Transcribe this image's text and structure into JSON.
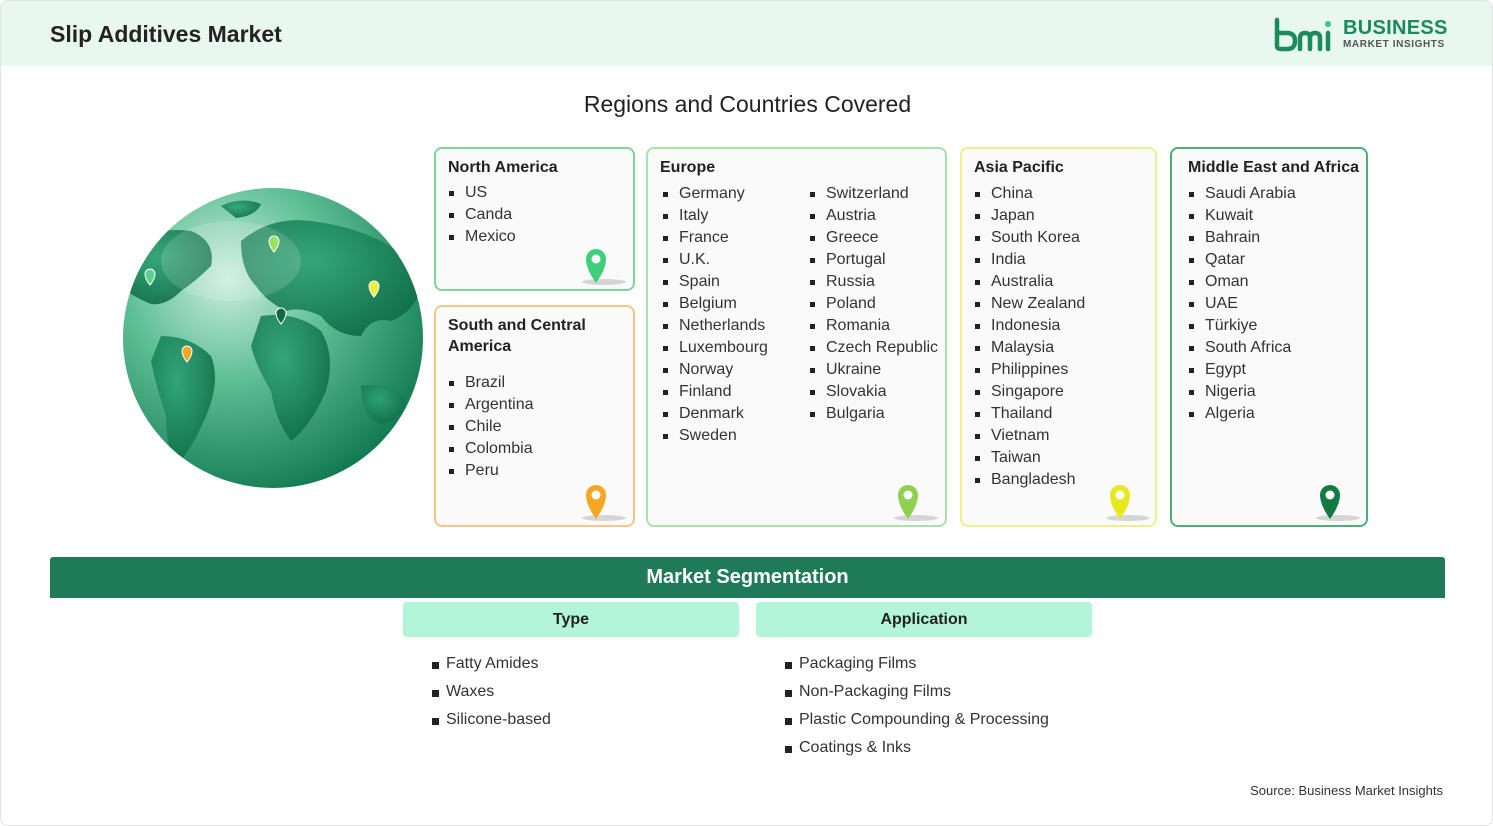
{
  "header": {
    "title": "Slip Additives Market"
  },
  "logo": {
    "mark": "bmi",
    "line1": "BUSINESS",
    "line2": "MARKET INSIGHTS"
  },
  "regions_title": "Regions and Countries Covered",
  "colors": {
    "north_america": "#7ed49a",
    "south_america": "#f7c58a",
    "europe": "#a9e2a9",
    "asia_pacific": "#f0ef8a",
    "middle_east": "#4caf7a",
    "segmentation_bar": "#1f7a5a",
    "segment_head": "#b3f5d9"
  },
  "regions": [
    {
      "name": "North America",
      "countries": [
        "US",
        "Canda",
        "Mexico"
      ]
    },
    {
      "name": "South and Central America",
      "countries": [
        "Brazil",
        "Argentina",
        "Chile",
        "Colombia",
        "Peru"
      ]
    },
    {
      "name": "Europe",
      "countries_col1": [
        "Germany",
        "Italy",
        "France",
        "U.K.",
        "Spain",
        "Belgium",
        "Netherlands",
        "Luxembourg",
        "Norway",
        "Finland",
        "Denmark",
        "Sweden"
      ],
      "countries_col2": [
        "Switzerland",
        "Austria",
        "Greece",
        "Portugal",
        "Russia",
        "Poland",
        "Romania",
        "Czech Republic",
        "Ukraine",
        "Slovakia",
        "Bulgaria"
      ]
    },
    {
      "name": "Asia Pacific",
      "countries": [
        "China",
        "Japan",
        "South Korea",
        "India",
        "Australia",
        "New Zealand",
        "Indonesia",
        "Malaysia",
        "Philippines",
        "Singapore",
        "Thailand",
        "Vietnam",
        "Taiwan",
        "Bangladesh"
      ]
    },
    {
      "name": "Middle East and Africa",
      "countries": [
        "Saudi Arabia",
        "Kuwait",
        "Bahrain",
        "Qatar",
        "Oman",
        "UAE",
        "Türkiye",
        "South Africa",
        "Egypt",
        "Nigeria",
        "Algeria"
      ]
    }
  ],
  "segmentation": {
    "title": "Market Segmentation",
    "groups": [
      {
        "name": "Type",
        "items": [
          "Fatty Amides",
          "Waxes",
          "Silicone-based"
        ]
      },
      {
        "name": "Application",
        "items": [
          "Packaging Films",
          "Non-Packaging Films",
          "Plastic Compounding & Processing",
          "Coatings & Inks"
        ]
      }
    ]
  },
  "icons": [
    "globe-icon",
    "location-pin-icon",
    "bmi-logo-icon"
  ],
  "source": "Source: Business Market Insights"
}
